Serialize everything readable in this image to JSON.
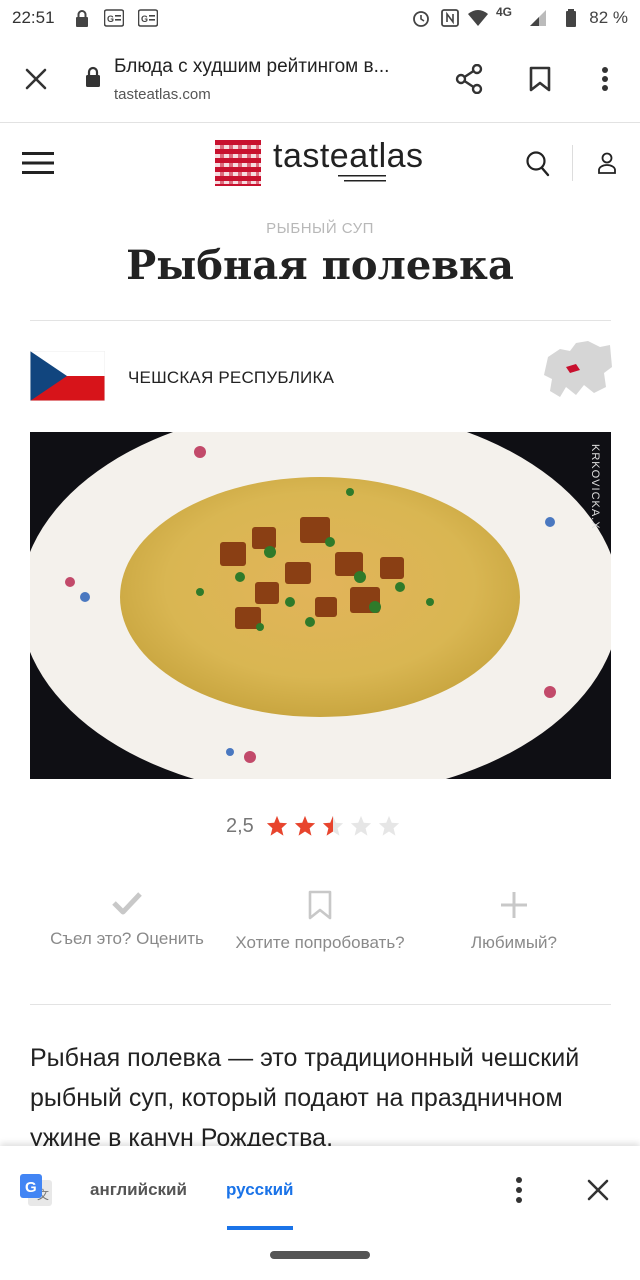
{
  "status_bar": {
    "time": "22:51",
    "network": "4G",
    "battery": "82 %"
  },
  "browser": {
    "page_title": "Блюда с худшим рейтингом в...",
    "url": "tasteatlas.com"
  },
  "site": {
    "logo_text": "tasteatlas",
    "brand_color": "#c8102e"
  },
  "dish": {
    "category": "РЫБНЫЙ СУП",
    "title": "Рыбная полевка",
    "country": "ЧЕШСКАЯ РЕСПУБЛИКА",
    "photo_credit": "KRKOVICKA.X",
    "rating": "2,5",
    "rating_stars": 2.5,
    "rating_max": 5
  },
  "actions": {
    "ate_label": "Съел это? Оценить",
    "want_label": "Хотите попробовать?",
    "favorite_label": "Любимый?"
  },
  "description": "Рыбная полевка — это традиционный чешский рыбный суп, который подают на праздничном ужине в канун Рождества.",
  "translate_bar": {
    "source_lang": "английский",
    "target_lang": "русский",
    "accent_color": "#1a73e8"
  }
}
